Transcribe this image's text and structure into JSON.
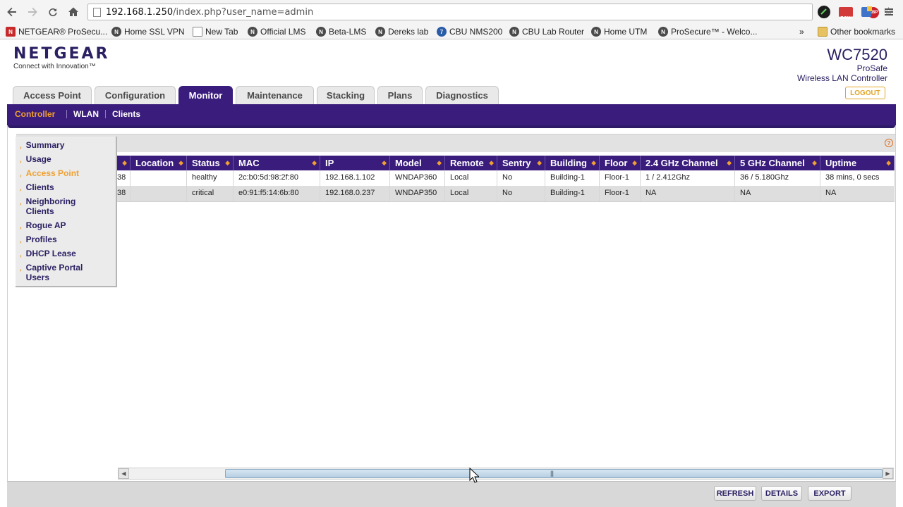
{
  "browser": {
    "url_host": "192.168.1.250",
    "url_path": "/index.php?user_name=admin",
    "bookmarks": [
      {
        "label": "NETGEAR® ProSecu...",
        "icon": "netgear-red-icon"
      },
      {
        "label": "Home SSL VPN",
        "icon": "netgear-globe-icon"
      },
      {
        "label": "New Tab",
        "icon": "page-icon"
      },
      {
        "label": "Official LMS",
        "icon": "netgear-globe-icon"
      },
      {
        "label": "Beta-LMS",
        "icon": "netgear-globe-icon"
      },
      {
        "label": "Dereks lab",
        "icon": "netgear-globe-icon"
      },
      {
        "label": "CBU NMS200",
        "icon": "nms-icon"
      },
      {
        "label": "CBU Lab Router",
        "icon": "netgear-globe-icon"
      },
      {
        "label": "Home UTM",
        "icon": "netgear-globe-icon"
      },
      {
        "label": "ProSecure™ - Welco...",
        "icon": "netgear-globe-icon"
      }
    ],
    "more_bookmarks": "»",
    "other_bookmarks": "Other bookmarks"
  },
  "header": {
    "brand": "NETGEAR",
    "tagline": "Connect with Innovation™",
    "model": "WC7520",
    "line1": "ProSafe",
    "line2": "Wireless LAN Controller",
    "logout": "LOGOUT"
  },
  "tabs": [
    "Access Point",
    "Configuration",
    "Monitor",
    "Maintenance",
    "Stacking",
    "Plans",
    "Diagnostics"
  ],
  "active_tab": "Monitor",
  "subnav": [
    "Controller",
    "WLAN",
    "Clients"
  ],
  "active_subnav": "Controller",
  "sidebar": [
    "Summary",
    "Usage",
    "Access Point",
    "Clients",
    "Neighboring Clients",
    "Rogue AP",
    "Profiles",
    "DHCP Lease",
    "Captive Portal Users"
  ],
  "active_sidebar": "Access Point",
  "table": {
    "columns": [
      "",
      "Location",
      "Status",
      "MAC",
      "IP",
      "Model",
      "Remote",
      "Sentry",
      "Building",
      "Floor",
      "2.4 GHz Channel",
      "5 GHz Channel",
      "Uptime"
    ],
    "rows": [
      [
        "38",
        "",
        "healthy",
        "2c:b0:5d:98:2f:80",
        "192.168.1.102",
        "WNDAP360",
        "Local",
        "No",
        "Building-1",
        "Floor-1",
        "1 / 2.412Ghz",
        "36 / 5.180Ghz",
        "38 mins, 0 secs"
      ],
      [
        "38",
        "",
        "critical",
        "e0:91:f5:14:6b:80",
        "192.168.0.237",
        "WNDAP350",
        "Local",
        "No",
        "Building-1",
        "Floor-1",
        "NA",
        "NA",
        "NA"
      ]
    ]
  },
  "footer_buttons": [
    "REFRESH",
    "DETAILS",
    "EXPORT"
  ],
  "colors": {
    "brand_purple": "#3a1c7d",
    "accent_orange": "#f0a030"
  }
}
